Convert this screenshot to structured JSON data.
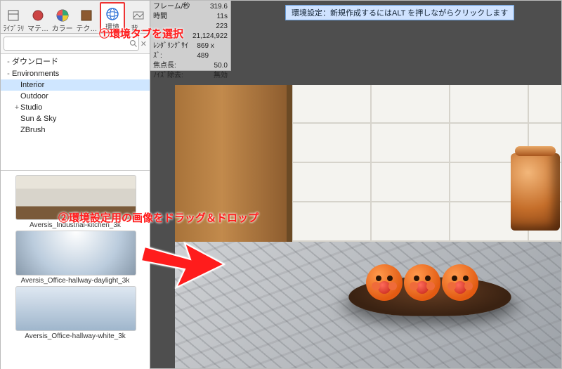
{
  "panel_title": "環境",
  "tabs": [
    {
      "id": "library",
      "label": "ﾗｲﾌﾞﾗﾘ"
    },
    {
      "id": "material",
      "label": "マテ…"
    },
    {
      "id": "color",
      "label": "カラー"
    },
    {
      "id": "texture",
      "label": "テク…"
    },
    {
      "id": "environment",
      "label": "環境",
      "selected": true
    },
    {
      "id": "backplate",
      "label": "背…"
    }
  ],
  "search": {
    "value": "",
    "placeholder": ""
  },
  "tree": [
    {
      "lvl": 0,
      "tw": "-",
      "label": "ダウンロード"
    },
    {
      "lvl": 0,
      "tw": "-",
      "label": "Environments"
    },
    {
      "lvl": 1,
      "tw": "",
      "label": "Interior",
      "selected": true
    },
    {
      "lvl": 1,
      "tw": "",
      "label": "Outdoor"
    },
    {
      "lvl": 1,
      "tw": "+",
      "label": "Studio"
    },
    {
      "lvl": 1,
      "tw": "",
      "label": "Sun & Sky"
    },
    {
      "lvl": 1,
      "tw": "",
      "label": "ZBrush"
    }
  ],
  "thumbs": [
    {
      "cls": "kitchen",
      "caption": "Aversis_Industrial-kitchen_3k"
    },
    {
      "cls": "office1",
      "caption": "Aversis_Office-hallway-daylight_3k"
    },
    {
      "cls": "office2",
      "caption": "Aversis_Office-hallway-white_3k"
    }
  ],
  "stats": {
    "rows": [
      {
        "k": "フレーム/秒",
        "v": "319.6"
      },
      {
        "k": "時間",
        "v": "11s"
      },
      {
        "k": "",
        "v": "223"
      },
      {
        "k": "",
        "v": "21,124,922"
      },
      {
        "k": "ﾚﾝﾀﾞﾘﾝｸﾞｻｲｽﾞ:",
        "v": "869 x 489"
      },
      {
        "k": "焦点長:",
        "v": "50.0"
      },
      {
        "k": "ﾉｲｽﾞ除去:",
        "v": "無効"
      }
    ]
  },
  "hint": "環境設定：新規作成するにはALT を押しながらクリックします",
  "annotations": {
    "a1": "①環境タブを選択",
    "a2": "②環境設定用の画像をドラッグ＆ドロップ"
  },
  "colors": {
    "accent": "#ff1a1a",
    "selection": "#cfe6ff",
    "hint_bg": "#cfe2ff"
  }
}
